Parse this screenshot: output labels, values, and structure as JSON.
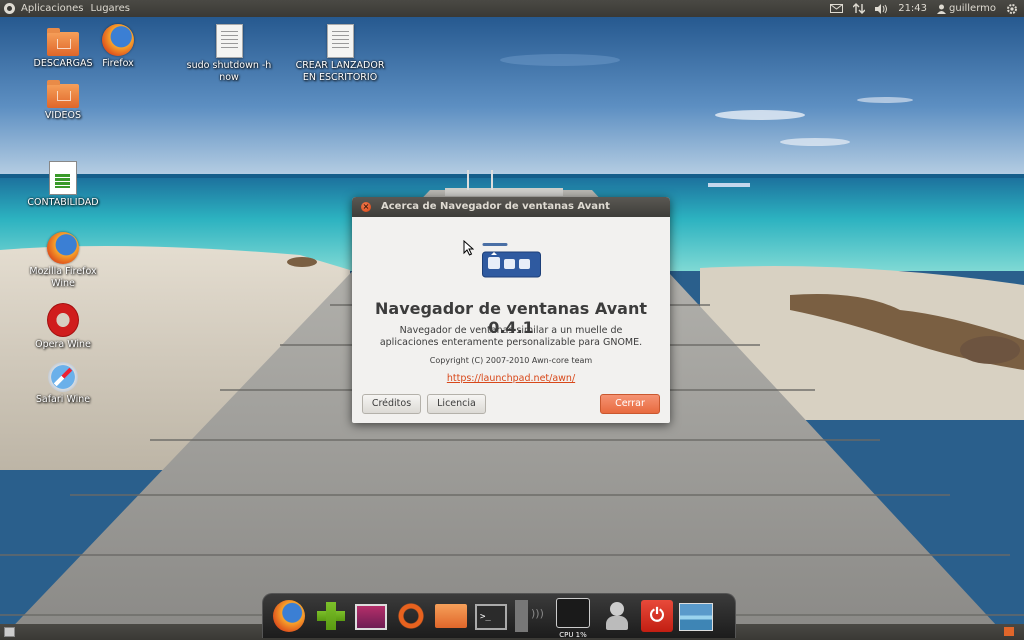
{
  "top_panel": {
    "menu": [
      "Aplicaciones",
      "Lugares"
    ],
    "clock": "21:43",
    "user": "guillermo"
  },
  "desktop_icons": [
    {
      "label": "DESCARGAS",
      "icon": "folder-download-icon"
    },
    {
      "label": "Firefox",
      "icon": "firefox-icon"
    },
    {
      "label": "sudo shutdown -h now",
      "icon": "text-file-icon"
    },
    {
      "label": "CREAR LANZADOR EN ESCRITORIO",
      "icon": "text-file-icon"
    },
    {
      "label": "VIDEOS",
      "icon": "folder-video-icon"
    },
    {
      "label": "CONTABILIDAD",
      "icon": "spreadsheet-icon"
    },
    {
      "label": "Mozilla Firefox Wine",
      "icon": "firefox-icon"
    },
    {
      "label": "Opera Wine",
      "icon": "opera-icon"
    },
    {
      "label": "Safari Wine",
      "icon": "safari-icon"
    }
  ],
  "dialog": {
    "title": "Acerca de Navegador de ventanas Avant",
    "app_name": "Navegador de ventanas Avant 0.4.1",
    "description": "Navegador de ventanas similar a un muelle de aplicaciones enteramente personalizable para GNOME.",
    "copyright": "Copyright (C) 2007-2010 Awn-core team",
    "website": "https://launchpad.net/awn/",
    "buttons": {
      "credits": "Créditos",
      "license": "Licencia",
      "close": "Cerrar"
    }
  },
  "dock": {
    "items": [
      "firefox-icon",
      "add-icon",
      "screen-icon",
      "ubuntu-icon",
      "folder-icon",
      "terminal-icon",
      "volume-icon",
      "cpu-monitor-icon",
      "user-switch-icon",
      "power-icon",
      "wallpaper-icon"
    ],
    "cpu_label": "CPU 1%"
  },
  "colors": {
    "accent": "#e86a3f",
    "link": "#d8481a",
    "panel": "#3a3935"
  }
}
